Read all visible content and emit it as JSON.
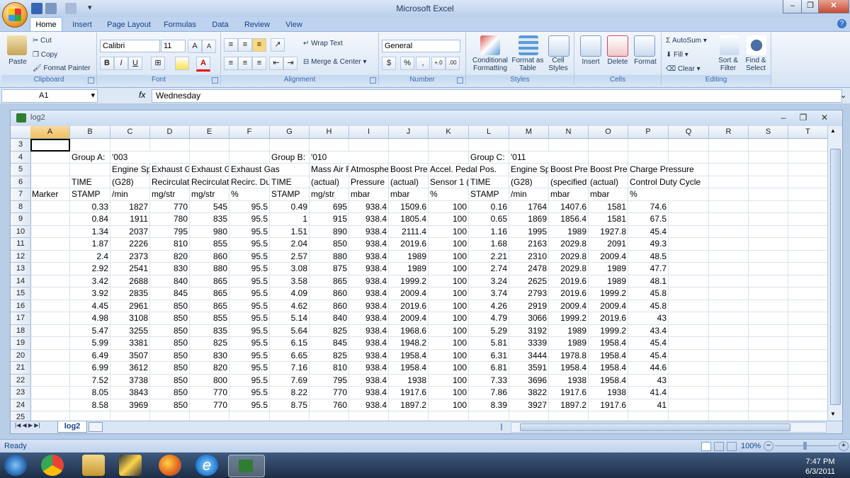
{
  "app_title": "Microsoft Excel",
  "ribbon": {
    "tabs": [
      "Home",
      "Insert",
      "Page Layout",
      "Formulas",
      "Data",
      "Review",
      "View"
    ],
    "clipboard": {
      "label": "Clipboard",
      "paste": "Paste",
      "cut": "Cut",
      "copy": "Copy",
      "format_painter": "Format Painter"
    },
    "font": {
      "label": "Font",
      "name": "Calibri",
      "size": "11",
      "bold": "B",
      "italic": "I",
      "underline": "U",
      "grow": "A",
      "shrink": "A",
      "font_color": "A"
    },
    "alignment": {
      "label": "Alignment",
      "wrap_text": "Wrap Text",
      "merge_center": "Merge & Center"
    },
    "number": {
      "label": "Number",
      "format": "General",
      "currency": "$",
      "percent": "%",
      "comma": ",",
      "inc_decimal": "+.0",
      "dec_decimal": ".00"
    },
    "styles": {
      "label": "Styles",
      "conditional_formatting": "Conditional Formatting",
      "format_as_table": "Format as Table",
      "cell_styles": "Cell Styles"
    },
    "cells": {
      "label": "Cells",
      "insert": "Insert",
      "delete": "Delete",
      "format": "Format"
    },
    "editing": {
      "label": "Editing",
      "autosum": "AutoSum",
      "fill": "Fill",
      "clear": "Clear",
      "sort_filter": "Sort & Filter",
      "find_select": "Find & Select"
    }
  },
  "formula_bar": {
    "name_box": "A1",
    "fx": "fx",
    "formula": "Wednesday"
  },
  "workbook": {
    "title": "log2",
    "sheet_tab": "log2"
  },
  "columns": [
    "A",
    "B",
    "C",
    "D",
    "E",
    "F",
    "G",
    "H",
    "I",
    "J",
    "K",
    "L",
    "M",
    "N",
    "O",
    "P",
    "Q",
    "R",
    "S",
    "T"
  ],
  "rows": [
    {
      "n": "3",
      "cells": [
        "",
        "",
        "",
        "",
        "",
        "",
        "",
        "",
        "",
        "",
        "",
        "",
        "",
        "",
        "",
        ""
      ]
    },
    {
      "n": "4",
      "cells": [
        "",
        "Group A:",
        "'003",
        "",
        "",
        "",
        "Group B:",
        "'010",
        "",
        "",
        "",
        "Group C:",
        "'011",
        "",
        "",
        ""
      ]
    },
    {
      "n": "5",
      "cells": [
        "",
        "",
        "Engine Sp",
        "Exhaust G",
        "Exhaust G",
        "Exhaust Gas",
        "",
        "Mass Air F",
        "Atmosphe",
        "Boost Pre",
        "Accel. Pedal Pos.",
        "",
        "Engine Sp",
        "Boost Pre",
        "Boost Pre",
        "Charge Pressure"
      ]
    },
    {
      "n": "6",
      "cells": [
        "",
        "TIME",
        "(G28)",
        "Recirculat",
        "Recirculat",
        "Recirc. Du",
        "TIME",
        "(actual)",
        "Pressure",
        "(actual)",
        "Sensor 1 (",
        "TIME",
        "(G28)",
        "(specified",
        "(actual)",
        "Control Duty Cycle"
      ]
    },
    {
      "n": "7",
      "cells": [
        "Marker",
        "STAMP",
        "/min",
        "mg/str",
        "mg/str",
        "%",
        "STAMP",
        "mg/str",
        "mbar",
        "mbar",
        "%",
        "STAMP",
        "/min",
        "mbar",
        "mbar",
        "%"
      ]
    },
    {
      "n": "8",
      "cells": [
        "",
        "0.33",
        "1827",
        "770",
        "545",
        "95.5",
        "0.49",
        "695",
        "938.4",
        "1509.6",
        "100",
        "0.16",
        "1764",
        "1407.6",
        "1581",
        "74.6"
      ]
    },
    {
      "n": "9",
      "cells": [
        "",
        "0.84",
        "1911",
        "780",
        "835",
        "95.5",
        "1",
        "915",
        "938.4",
        "1805.4",
        "100",
        "0.65",
        "1869",
        "1856.4",
        "1581",
        "67.5"
      ]
    },
    {
      "n": "10",
      "cells": [
        "",
        "1.34",
        "2037",
        "795",
        "980",
        "95.5",
        "1.51",
        "890",
        "938.4",
        "2111.4",
        "100",
        "1.16",
        "1995",
        "1989",
        "1927.8",
        "45.4"
      ]
    },
    {
      "n": "11",
      "cells": [
        "",
        "1.87",
        "2226",
        "810",
        "855",
        "95.5",
        "2.04",
        "850",
        "938.4",
        "2019.6",
        "100",
        "1.68",
        "2163",
        "2029.8",
        "2091",
        "49.3"
      ]
    },
    {
      "n": "12",
      "cells": [
        "",
        "2.4",
        "2373",
        "820",
        "860",
        "95.5",
        "2.57",
        "880",
        "938.4",
        "1989",
        "100",
        "2.21",
        "2310",
        "2029.8",
        "2009.4",
        "48.5"
      ]
    },
    {
      "n": "13",
      "cells": [
        "",
        "2.92",
        "2541",
        "830",
        "880",
        "95.5",
        "3.08",
        "875",
        "938.4",
        "1989",
        "100",
        "2.74",
        "2478",
        "2029.8",
        "1989",
        "47.7"
      ]
    },
    {
      "n": "14",
      "cells": [
        "",
        "3.42",
        "2688",
        "840",
        "865",
        "95.5",
        "3.58",
        "865",
        "938.4",
        "1999.2",
        "100",
        "3.24",
        "2625",
        "2019.6",
        "1989",
        "48.1"
      ]
    },
    {
      "n": "15",
      "cells": [
        "",
        "3.92",
        "2835",
        "845",
        "865",
        "95.5",
        "4.09",
        "860",
        "938.4",
        "2009.4",
        "100",
        "3.74",
        "2793",
        "2019.6",
        "1999.2",
        "45.8"
      ]
    },
    {
      "n": "16",
      "cells": [
        "",
        "4.45",
        "2961",
        "850",
        "865",
        "95.5",
        "4.62",
        "860",
        "938.4",
        "2019.6",
        "100",
        "4.26",
        "2919",
        "2009.4",
        "2009.4",
        "45.8"
      ]
    },
    {
      "n": "17",
      "cells": [
        "",
        "4.98",
        "3108",
        "850",
        "855",
        "95.5",
        "5.14",
        "840",
        "938.4",
        "2009.4",
        "100",
        "4.79",
        "3066",
        "1999.2",
        "2019.6",
        "43"
      ]
    },
    {
      "n": "18",
      "cells": [
        "",
        "5.47",
        "3255",
        "850",
        "835",
        "95.5",
        "5.64",
        "825",
        "938.4",
        "1968.6",
        "100",
        "5.29",
        "3192",
        "1989",
        "1999.2",
        "43.4"
      ]
    },
    {
      "n": "19",
      "cells": [
        "",
        "5.99",
        "3381",
        "850",
        "825",
        "95.5",
        "6.15",
        "845",
        "938.4",
        "1948.2",
        "100",
        "5.81",
        "3339",
        "1989",
        "1958.4",
        "45.4"
      ]
    },
    {
      "n": "20",
      "cells": [
        "",
        "6.49",
        "3507",
        "850",
        "830",
        "95.5",
        "6.65",
        "825",
        "938.4",
        "1958.4",
        "100",
        "6.31",
        "3444",
        "1978.8",
        "1958.4",
        "45.4"
      ]
    },
    {
      "n": "21",
      "cells": [
        "",
        "6.99",
        "3612",
        "850",
        "820",
        "95.5",
        "7.16",
        "810",
        "938.4",
        "1958.4",
        "100",
        "6.81",
        "3591",
        "1958.4",
        "1958.4",
        "44.6"
      ]
    },
    {
      "n": "22",
      "cells": [
        "",
        "7.52",
        "3738",
        "850",
        "800",
        "95.5",
        "7.69",
        "795",
        "938.4",
        "1938",
        "100",
        "7.33",
        "3696",
        "1938",
        "1958.4",
        "43"
      ]
    },
    {
      "n": "23",
      "cells": [
        "",
        "8.05",
        "3843",
        "850",
        "770",
        "95.5",
        "8.22",
        "770",
        "938.4",
        "1917.6",
        "100",
        "7.86",
        "3822",
        "1917.6",
        "1938",
        "41.4"
      ]
    },
    {
      "n": "24",
      "cells": [
        "",
        "8.58",
        "3969",
        "850",
        "770",
        "95.5",
        "8.75",
        "760",
        "938.4",
        "1897.2",
        "100",
        "8.39",
        "3927",
        "1897.2",
        "1917.6",
        "41"
      ]
    },
    {
      "n": "25",
      "cells": [
        "",
        "",
        "",
        "",
        "",
        "",
        "",
        "",
        "",
        "",
        "",
        "",
        "",
        "",
        "",
        ""
      ]
    }
  ],
  "status": {
    "ready": "Ready",
    "zoom": "100%"
  },
  "clock": {
    "time": "7:47 PM",
    "date": "6/3/2011"
  }
}
